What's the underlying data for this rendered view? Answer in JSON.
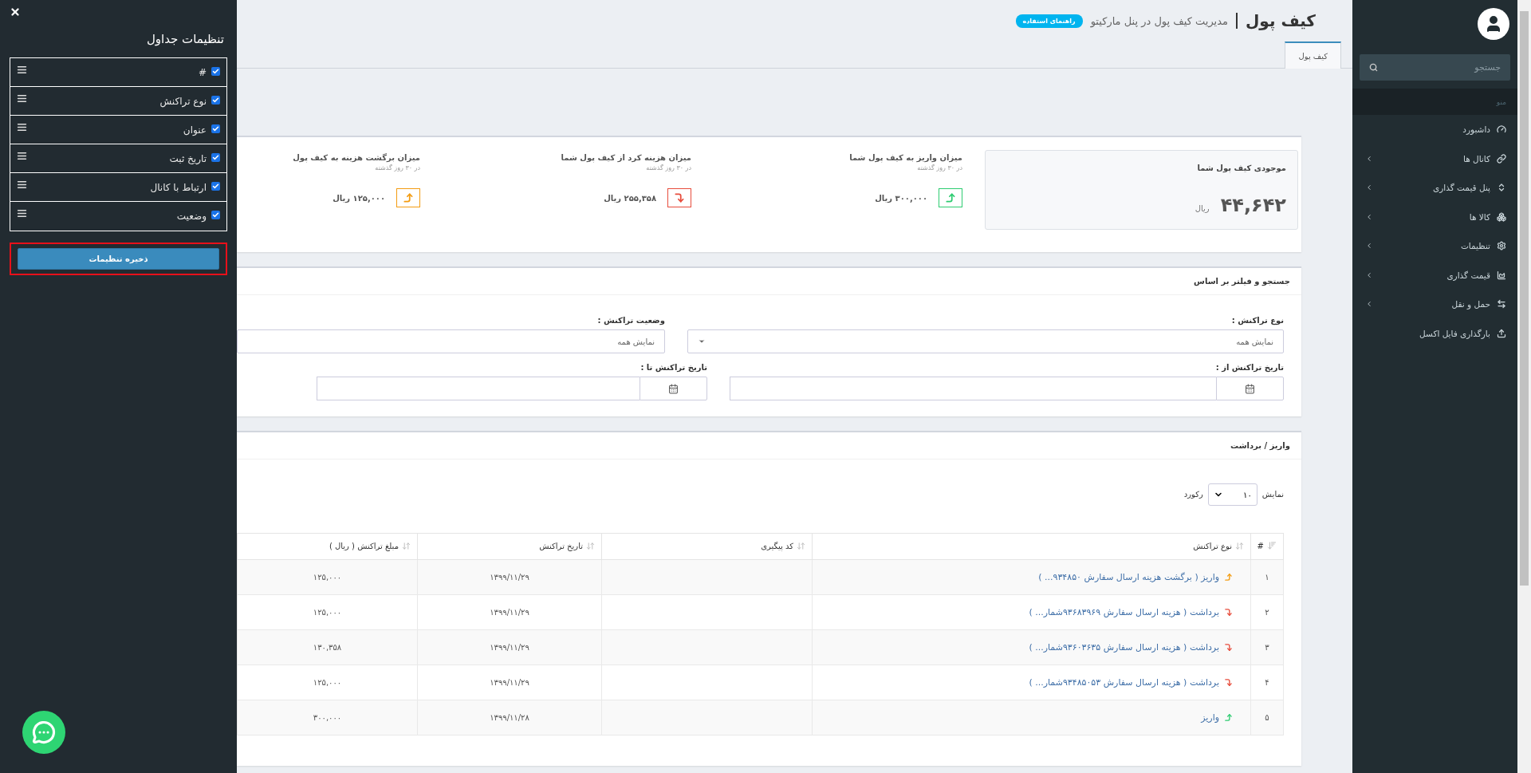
{
  "settings_panel": {
    "title": "تنظیمات جداول",
    "columns": [
      {
        "label": "#",
        "checked": true
      },
      {
        "label": "نوع تراکنش",
        "checked": true
      },
      {
        "label": "عنوان",
        "checked": true
      },
      {
        "label": "تاریخ ثبت",
        "checked": true
      },
      {
        "label": "ارتباط با کانال",
        "checked": true
      },
      {
        "label": "وضعیت",
        "checked": true
      }
    ],
    "save_button": "ذخیره تنظیمات"
  },
  "header": {
    "title": "کیف پول",
    "subtitle": "مدیریت کیف پول در پنل مارکیتو",
    "help_button": "راهنمای استفاده"
  },
  "tabs": [
    {
      "label": "کیف پول",
      "selected": true
    }
  ],
  "balance": {
    "title": "موجودی کیف پول شما",
    "amount": "۴۴,۶۴۲",
    "unit": "ریال"
  },
  "stats": [
    {
      "kind": "deposit",
      "title": "میزان واریز به کیف پول شما",
      "period": "در ۳۰ روز گذشته",
      "amount": "۳۰۰,۰۰۰ ریال"
    },
    {
      "kind": "withdraw",
      "title": "میزان هزینه کرد از کیف پول شما",
      "period": "در ۳۰ روز گذشته",
      "amount": "۲۵۵,۳۵۸ ریال"
    },
    {
      "kind": "refund",
      "title": "میزان برگشت هزینه به کیف پول",
      "period": "در ۳۰ روز گذشته",
      "amount": "۱۲۵,۰۰۰ ریال"
    }
  ],
  "filter": {
    "title": "جستجو و فیلتر بر اساس",
    "fields": [
      {
        "kind": "select",
        "label": "نوع تراکنش :",
        "value": "نمایش همه"
      },
      {
        "kind": "text",
        "label": "وضعیت تراکنش :",
        "value": "نمایش همه"
      },
      {
        "kind": "date",
        "label": "تاریخ تراکنش از :"
      },
      {
        "kind": "date",
        "label": "تاریخ تراکنش تا :"
      }
    ]
  },
  "table": {
    "title": "واریز / برداشت",
    "length": {
      "before": "نمایش",
      "value": "۱۰",
      "after": "رکورد"
    },
    "columns": [
      "#",
      "نوع تراکنش",
      "کد پیگیری",
      "تاریخ تراکنش",
      "مبلغ تراکنش ( ریال )"
    ],
    "rows": [
      {
        "num": "۱",
        "kind": "refund",
        "type": "واریز ( برگشت هزینه ارسال سفارش ۹۳۴۸۵۰... )",
        "date": "۱۳۹۹/۱۱/۲۹",
        "amount": "۱۲۵,۰۰۰"
      },
      {
        "num": "۲",
        "kind": "withdraw",
        "type": "برداشت ( هزینه ارسال سفارش ۹۳۶۸۳۹۶۹شمار... )",
        "date": "۱۳۹۹/۱۱/۲۹",
        "amount": "۱۲۵,۰۰۰"
      },
      {
        "num": "۳",
        "kind": "withdraw",
        "type": "برداشت ( هزینه ارسال سفارش ۹۳۶۰۳۶۳۵شمار... )",
        "date": "۱۳۹۹/۱۱/۲۹",
        "amount": "۱۳۰,۳۵۸"
      },
      {
        "num": "۴",
        "kind": "withdraw",
        "type": "برداشت ( هزینه ارسال سفارش ۹۳۴۸۵۰۵۳شمار... )",
        "date": "۱۳۹۹/۱۱/۲۹",
        "amount": "۱۲۵,۰۰۰"
      },
      {
        "num": "۵",
        "kind": "deposit",
        "type": "واریز",
        "date": "۱۳۹۹/۱۱/۲۸",
        "amount": "۳۰۰,۰۰۰"
      }
    ]
  },
  "sidebar": {
    "search_placeholder": "جستجو",
    "menu_header": "منو",
    "items": [
      {
        "label": "داشبورد",
        "has_children": false
      },
      {
        "label": "کانال ها",
        "has_children": true
      },
      {
        "label": "پنل قیمت گذاری",
        "has_children": true
      },
      {
        "label": "کالا ها",
        "has_children": true
      },
      {
        "label": "تنظیمات",
        "has_children": true
      },
      {
        "label": "قیمت گذاری",
        "has_children": true
      },
      {
        "label": "حمل و نقل",
        "has_children": true
      },
      {
        "label": "بارگذاری فایل اکسل",
        "has_children": false
      }
    ]
  }
}
